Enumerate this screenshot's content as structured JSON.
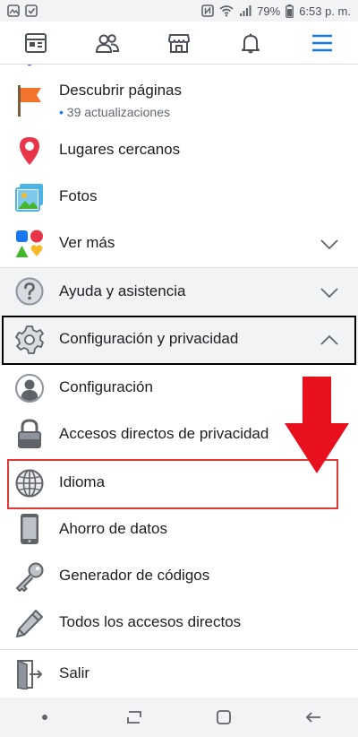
{
  "status_bar": {
    "battery": "79%",
    "time": "6:53 p. m."
  },
  "nav": {
    "items": [
      {
        "icon": "news-feed-icon"
      },
      {
        "icon": "friends-icon"
      },
      {
        "icon": "marketplace-icon"
      },
      {
        "icon": "notifications-bell-icon"
      },
      {
        "icon": "menu-hamburger-icon"
      }
    ]
  },
  "menu": {
    "items": [
      {
        "label": "Descubrir páginas",
        "sub": "39 actualizaciones",
        "icon": "flag-icon"
      },
      {
        "label": "Lugares cercanos",
        "icon": "map-pin-icon"
      },
      {
        "label": "Fotos",
        "icon": "photos-icon"
      },
      {
        "label": "Ver más",
        "icon": "shapes-icon"
      },
      {
        "label": "Ayuda y asistencia",
        "icon": "help-icon"
      },
      {
        "label": "Configuración y privacidad",
        "icon": "gear-icon"
      },
      {
        "label": "Configuración",
        "icon": "user-icon"
      },
      {
        "label": "Accesos directos de privacidad",
        "icon": "lock-icon"
      },
      {
        "label": "Idioma",
        "icon": "globe-icon"
      },
      {
        "label": "Ahorro de datos",
        "icon": "phone-icon"
      },
      {
        "label": "Generador de códigos",
        "icon": "key-icon"
      },
      {
        "label": "Todos los accesos directos",
        "icon": "pencil-icon"
      },
      {
        "label": "Salir",
        "icon": "exit-door-icon"
      }
    ]
  },
  "colors": {
    "accent": "#1877f2",
    "highlight_red": "#e53935",
    "arrow_red": "#e8101d",
    "section_bg": "#f2f3f5"
  }
}
